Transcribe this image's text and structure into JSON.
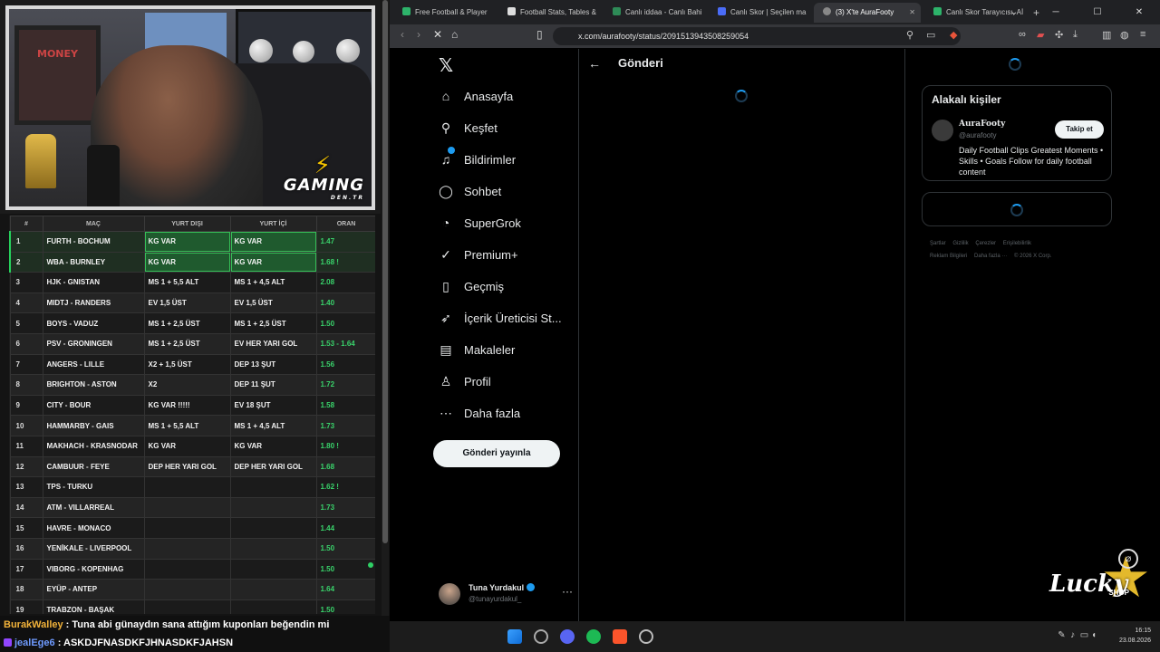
{
  "stream": {
    "overlay_logo": "GAMING",
    "overlay_logo_sub": "DEN.TR",
    "poster_text": "MONEY"
  },
  "coupon": {
    "headers": [
      "#",
      "MAÇ",
      "YURT DIŞI",
      "YURT İÇİ",
      "ORAN"
    ],
    "rows": [
      {
        "n": "1",
        "match": "FURTH - BOCHUM",
        "abroad": "KG VAR",
        "domestic": "KG VAR",
        "odds": "1.47",
        "hit": true
      },
      {
        "n": "2",
        "match": "WBA - BURNLEY",
        "abroad": "KG VAR",
        "domestic": "KG VAR",
        "odds": "1.68 !",
        "hit": true
      },
      {
        "n": "3",
        "match": "HJK - GNISTAN",
        "abroad": "MS 1 + 5,5 ALT",
        "domestic": "MS 1 + 4,5 ALT",
        "odds": "2.08",
        "hit": false
      },
      {
        "n": "4",
        "match": "MIDTJ - RANDERS",
        "abroad": "EV 1,5 ÜST",
        "domestic": "EV 1,5 ÜST",
        "odds": "1.40",
        "hit": false
      },
      {
        "n": "5",
        "match": "BOYS - VADUZ",
        "abroad": "MS 1 + 2,5 ÜST",
        "domestic": "MS 1 + 2,5 ÜST",
        "odds": "1.50",
        "hit": false
      },
      {
        "n": "6",
        "match": "PSV - GRONINGEN",
        "abroad": "MS 1 + 2,5 ÜST",
        "domestic": "EV HER YARI GOL",
        "odds": "1.53 - 1.64",
        "hit": false
      },
      {
        "n": "7",
        "match": "ANGERS - LILLE",
        "abroad": "X2 + 1,5 ÜST",
        "domestic": "DEP 13 ŞUT",
        "odds": "1.56",
        "hit": false
      },
      {
        "n": "8",
        "match": "BRIGHTON - ASTON",
        "abroad": "X2",
        "domestic": "DEP 11 ŞUT",
        "odds": "1.72",
        "hit": false
      },
      {
        "n": "9",
        "match": "CITY - BOUR",
        "abroad": "KG VAR !!!!!",
        "domestic": "EV 18 ŞUT",
        "odds": "1.58",
        "hit": false
      },
      {
        "n": "10",
        "match": "HAMMARBY - GAIS",
        "abroad": "MS 1 + 5,5 ALT",
        "domestic": "MS 1 + 4,5 ALT",
        "odds": "1.73",
        "hit": false
      },
      {
        "n": "11",
        "match": "MAKHACH - KRASNODAR",
        "abroad": "KG VAR",
        "domestic": "KG VAR",
        "odds": "1.80 !",
        "hit": false
      },
      {
        "n": "12",
        "match": "CAMBUUR - FEYE",
        "abroad": "DEP HER YARI GOL",
        "domestic": "DEP HER YARI GOL",
        "odds": "1.68",
        "hit": false
      },
      {
        "n": "13",
        "match": "TPS - TURKU",
        "abroad": "",
        "domestic": "",
        "odds": "1.62 !",
        "hit": false
      },
      {
        "n": "14",
        "match": "ATM - VILLARREAL",
        "abroad": "",
        "domestic": "",
        "odds": "1.73",
        "hit": false
      },
      {
        "n": "15",
        "match": "HAVRE - MONACO",
        "abroad": "",
        "domestic": "",
        "odds": "1.44",
        "hit": false
      },
      {
        "n": "16",
        "match": "YENİKALE - LIVERPOOL",
        "abroad": "",
        "domestic": "",
        "odds": "1.50",
        "hit": false
      },
      {
        "n": "17",
        "match": "VIBORG - KOPENHAG",
        "abroad": "",
        "domestic": "",
        "odds": "1.50",
        "hit": false
      },
      {
        "n": "18",
        "match": "EYÜP - ANTEP",
        "abroad": "",
        "domestic": "",
        "odds": "1.64",
        "hit": false
      },
      {
        "n": "19",
        "match": "TRABZON - BAŞAK",
        "abroad": "",
        "domestic": "",
        "odds": "1.50",
        "hit": false
      }
    ]
  },
  "chat": [
    {
      "user": "BurakWalley",
      "sep": " : ",
      "text": "Tuna abi günaydın sana attığım kuponları beğendin mi"
    },
    {
      "user": "jealEge6",
      "sep": " : ",
      "text": "ASKDJFNASDKFJHNASDKFJAHSN"
    }
  ],
  "browser": {
    "tabs": [
      {
        "label": "Free Football & Player",
        "color": "#2db36a",
        "active": false
      },
      {
        "label": "Football Stats, Tables &",
        "color": "#dddddd",
        "active": false
      },
      {
        "label": "Canlı iddaa - Canlı Bahi",
        "color": "#2e8b57",
        "active": false
      },
      {
        "label": "Canlı Skor | Seçilen ma",
        "color": "#4a6cf7",
        "active": false
      },
      {
        "label": "(3) X'te AuraFooty",
        "color": "#888888",
        "active": true
      },
      {
        "label": "Canlı Skor Tarayıcısı, Aİ",
        "color": "#2db36a",
        "active": false
      }
    ],
    "new_tab": "+",
    "url": "x.com/aurafooty/status/2091513943508259054"
  },
  "x": {
    "nav": [
      {
        "label": "Anasayfa",
        "icon": "home-icon",
        "glyph": "⌂"
      },
      {
        "label": "Keşfet",
        "icon": "search-icon",
        "glyph": "⚲"
      },
      {
        "label": "Bildirimler",
        "icon": "bell-icon",
        "glyph": "♫"
      },
      {
        "label": "Sohbet",
        "icon": "chat-icon",
        "glyph": "◯"
      },
      {
        "label": "SuperGrok",
        "icon": "grok-icon",
        "glyph": "◔"
      },
      {
        "label": "Premium+",
        "icon": "premium-icon",
        "glyph": "✓"
      },
      {
        "label": "Geçmiş",
        "icon": "bookmark-icon",
        "glyph": "▯"
      },
      {
        "label": "İçerik Üreticisi St...",
        "icon": "rocket-icon",
        "glyph": "➶"
      },
      {
        "label": "Makaleler",
        "icon": "articles-icon",
        "glyph": "▤"
      },
      {
        "label": "Profil",
        "icon": "person-icon",
        "glyph": "♙"
      },
      {
        "label": "Daha fazla",
        "icon": "more-icon",
        "glyph": "⋯"
      }
    ],
    "post_button": "Gönderi yayınla",
    "main_title": "Gönderi",
    "account": {
      "name": "Tuna Yurdakul",
      "handle": "@tunayurdakul_"
    },
    "related": {
      "title": "Alakalı kişiler",
      "name": "AuraFooty",
      "handle": "@aurafooty",
      "bio": "Daily Football Clips            Greatest Moments • Skills • Goals Follow for daily football content",
      "follow": "Takip et"
    },
    "footer": [
      "Şartlar",
      "Gizlilik",
      "Çerezler",
      "Erişilebilirlik",
      "Reklam Bilgileri",
      "Daha fazla ···",
      "© 2026 X Corp."
    ]
  },
  "overlay_brand": {
    "word": "Lucky",
    "shop": "SHOP"
  },
  "taskbar": {
    "time": "16:15",
    "date": "23.08.2026"
  }
}
